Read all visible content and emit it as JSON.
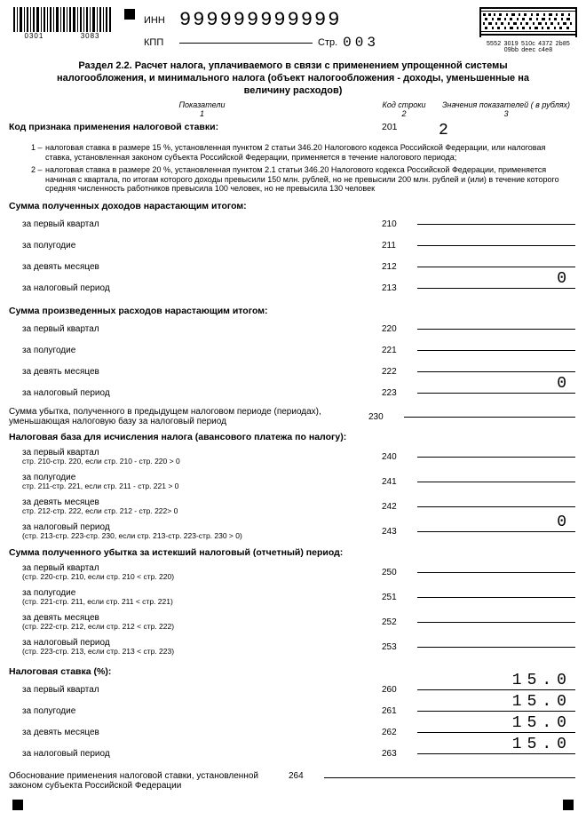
{
  "header": {
    "inn_label": "ИНН",
    "inn_value": "999999999999",
    "kpp_label": "КПП",
    "page_label": "Стр.",
    "page_value": "003",
    "bc_left_a": "0301",
    "bc_left_b": "3083",
    "bc2d_text": "5552 3019 510c 4372 2b85 09bb deec c4e8"
  },
  "title": "Раздел 2.2. Расчет налога, уплачиваемого в связи с применением упрощенной системы налогообложения, и минимального налога (объект налогообложения - доходы, уменьшенные на величину расходов)",
  "col_headers": {
    "c1": "Показатели",
    "c2": "Код строки",
    "c3": "Значения показателей ( в рублях)",
    "n1": "1",
    "n2": "2",
    "n3": "3"
  },
  "sign_row": {
    "label": "Код признака применения налоговой ставки:",
    "code": "201",
    "value": "2"
  },
  "notes": {
    "n1_num": "1 –",
    "n1_text": "налоговая ставка в размере 15 %, установленная пунктом 2 статьи 346.20 Налогового кодекса Российской Федерации, или налоговая ставка, установленная законом субъекта Российской Федерации, применяется в течение налогового периода;",
    "n2_num": "2 –",
    "n2_text": "налоговая ставка в размере 20 %, установленная пунктом 2.1 статьи 346.20 Налогового кодекса Российской Федерации, применяется начиная с квартала, по итогам которого доходы превысили 150 млн. рублей, но не превысили 200 млн. рублей и (или) в течение которого средняя численность работников превысила 100 человек, но не превысила 130 человек"
  },
  "sections": {
    "s1": {
      "title": "Сумма полученных доходов нарастающим итогом:",
      "rows": [
        {
          "label": "за первый квартал",
          "code": "210",
          "value": ""
        },
        {
          "label": "за полугодие",
          "code": "211",
          "value": ""
        },
        {
          "label": "за девять месяцев",
          "code": "212",
          "value": ""
        },
        {
          "label": "за налоговый период",
          "code": "213",
          "value": "0"
        }
      ]
    },
    "s2": {
      "title": "Сумма произведенных расходов нарастающим итогом:",
      "rows": [
        {
          "label": "за первый квартал",
          "code": "220",
          "value": ""
        },
        {
          "label": "за полугодие",
          "code": "221",
          "value": ""
        },
        {
          "label": "за девять месяцев",
          "code": "222",
          "value": ""
        },
        {
          "label": "за налоговый период",
          "code": "223",
          "value": "0"
        }
      ]
    },
    "s3": {
      "label": "Сумма убытка, полученного в предыдущем налоговом периоде (периодах), уменьшающая налоговую базу за налоговый период",
      "code": "230",
      "value": ""
    },
    "s4": {
      "title": "Налоговая база для исчисления налога (авансового платежа по налогу):",
      "rows": [
        {
          "label": "за первый квартал",
          "sub": "стр. 210-стр. 220, если стр. 210 - стр. 220 > 0",
          "code": "240",
          "value": ""
        },
        {
          "label": "за полугодие",
          "sub": "стр. 211-стр. 221, если стр. 211 - стр. 221 > 0",
          "code": "241",
          "value": ""
        },
        {
          "label": "за девять месяцев",
          "sub": "стр. 212-стр. 222, если стр.  212 - стр.  222> 0",
          "code": "242",
          "value": ""
        },
        {
          "label": "за налоговый период",
          "sub": "(стр. 213-стр. 223-стр. 230, если стр. 213-стр. 223-стр. 230 > 0)",
          "code": "243",
          "value": "0"
        }
      ]
    },
    "s5": {
      "title": "Сумма полученного убытка за истекший налоговый (отчетный) период:",
      "rows": [
        {
          "label": "за первый квартал",
          "sub": "(стр. 220-стр. 210, если стр. 210 < стр. 220)",
          "code": "250",
          "value": ""
        },
        {
          "label": "за полугодие",
          "sub": "(стр. 221-стр. 211, если стр. 211 < стр. 221)",
          "code": "251",
          "value": ""
        },
        {
          "label": "за девять месяцев",
          "sub": "(стр. 222-стр. 212, если стр. 212 < стр. 222)",
          "code": "252",
          "value": ""
        },
        {
          "label": "за налоговый период",
          "sub": "(стр. 223-стр. 213, если стр. 213 < стр. 223)",
          "code": "253",
          "value": ""
        }
      ]
    },
    "s6": {
      "title": "Налоговая ставка (%):",
      "rows": [
        {
          "label": "за первый квартал",
          "code": "260",
          "value": "15.0"
        },
        {
          "label": "за полугодие",
          "code": "261",
          "value": "15.0"
        },
        {
          "label": "за девять месяцев",
          "code": "262",
          "value": "15.0"
        },
        {
          "label": "за налоговый период",
          "code": "263",
          "value": "15.0"
        }
      ]
    },
    "s7": {
      "label": "Обоснование применения налоговой ставки, установленной законом субъекта Российской Федерации",
      "code": "264",
      "value": ""
    }
  }
}
